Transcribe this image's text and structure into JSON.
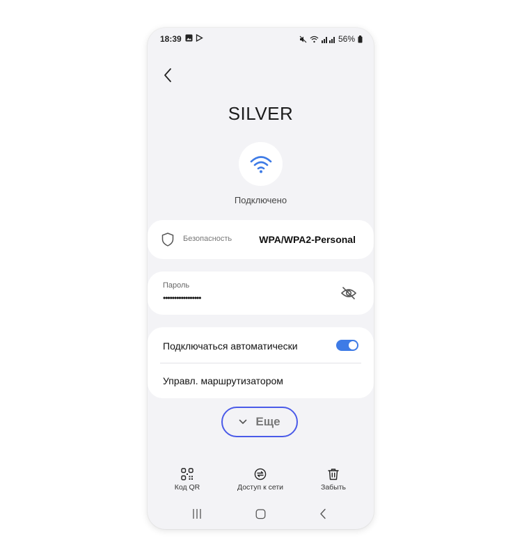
{
  "status_bar": {
    "time": "18:39",
    "battery": "56%"
  },
  "network": {
    "name": "SILVER",
    "status": "Подключено"
  },
  "security": {
    "label": "Безопасность",
    "value": "WPA/WPA2-Personal"
  },
  "password": {
    "label": "Пароль",
    "masked_value": "•••••••••••••••••"
  },
  "options": {
    "auto_connect_label": "Подключаться автоматически",
    "auto_connect_enabled": true,
    "router_label": "Управл. маршрутизатором"
  },
  "more_button": {
    "label": "Еще"
  },
  "actions": {
    "qr_label": "Код QR",
    "share_label": "Доступ к сети",
    "forget_label": "Забыть"
  },
  "colors": {
    "accent": "#3e7be6",
    "highlight_ring": "#4a5ae8",
    "background": "#f3f3f6"
  },
  "icons": [
    "back-arrow-icon",
    "wifi-icon",
    "shield-icon",
    "eye-off-icon",
    "chevron-down-icon",
    "qr-code-icon",
    "share-network-icon",
    "trash-icon",
    "recents-icon",
    "home-icon",
    "nav-back-icon"
  ]
}
